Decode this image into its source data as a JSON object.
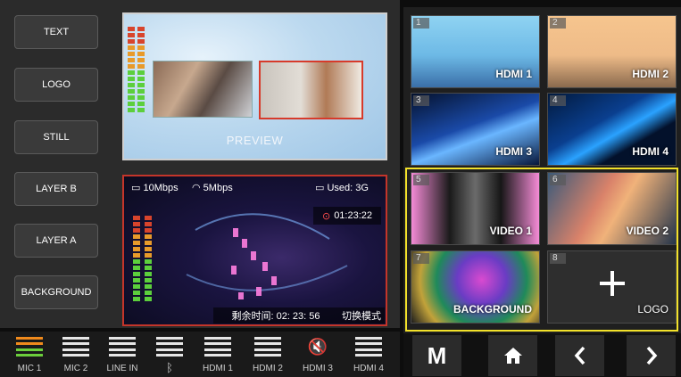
{
  "layer_buttons": [
    "TEXT",
    "LOGO",
    "STILL",
    "LAYER B",
    "LAYER A",
    "BACKGROUND"
  ],
  "preview": {
    "label": "PREVIEW"
  },
  "program": {
    "upload_rate": "10Mbps",
    "wifi_rate": "5Mbps",
    "storage_used": "Used: 3G",
    "record_time": "01:23:22",
    "remaining_time": "剩余时间: 02: 23: 56",
    "switch_mode_label": "切换模式"
  },
  "sources": [
    {
      "num": "1",
      "label": "HDMI 1"
    },
    {
      "num": "2",
      "label": "HDMI 2"
    },
    {
      "num": "3",
      "label": "HDMI 3"
    },
    {
      "num": "4",
      "label": "HDMI 4"
    },
    {
      "num": "5",
      "label": "VIDEO 1"
    },
    {
      "num": "6",
      "label": "VIDEO 2"
    },
    {
      "num": "7",
      "label": "BACKGROUND"
    },
    {
      "num": "8",
      "label": "LOGO"
    }
  ],
  "audio_channels": [
    "MIC 1",
    "MIC 2",
    "LINE IN",
    "",
    "HDMI 1",
    "HDMI 2",
    "HDMI 3",
    "HDMI 4"
  ],
  "audio_icons": [
    "mixer-active-icon",
    "mixer-icon",
    "mixer-icon",
    "bluetooth-icon",
    "mixer-icon",
    "mixer-icon",
    "muted-speaker-icon",
    "mixer-icon"
  ],
  "nav": {
    "m_label": "M"
  },
  "colors": {
    "selection": "#f2e12a",
    "program_border": "#c4352a",
    "mic1_active": "#f08a1c"
  }
}
